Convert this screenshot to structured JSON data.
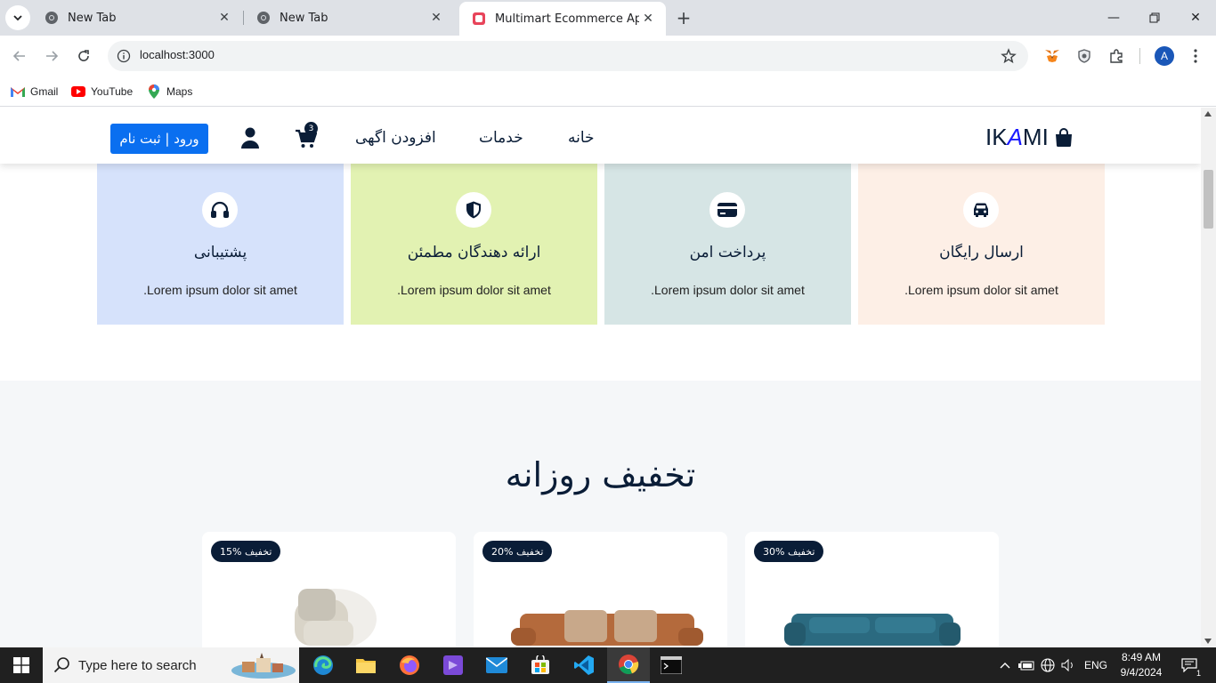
{
  "browser": {
    "tabs": [
      {
        "title": "New Tab"
      },
      {
        "title": "New Tab"
      },
      {
        "title": "Multimart Ecommerce App"
      }
    ],
    "url": "localhost:3000",
    "bookmarks": [
      {
        "label": "Gmail"
      },
      {
        "label": "YouTube"
      },
      {
        "label": "Maps"
      }
    ],
    "profile_initial": "A"
  },
  "site": {
    "logo_prefix": "IK",
    "logo_accent": "A",
    "logo_suffix": "MI",
    "nav": [
      {
        "label": "خانه"
      },
      {
        "label": "خدمات"
      },
      {
        "label": "افزودن اگهی"
      }
    ],
    "cart_count": "3",
    "login_label": "ورود | ثبت نام"
  },
  "services": [
    {
      "title": "ارسال رایگان",
      "desc": ".Lorem ipsum dolor sit amet",
      "icon": "car-icon",
      "bg": "#fdefe6"
    },
    {
      "title": "پرداخت امن",
      "desc": ".Lorem ipsum dolor sit amet",
      "icon": "credit-card-icon",
      "bg": "#d6e5e5"
    },
    {
      "title": "ارائه دهندگان مطمئن",
      "desc": ".Lorem ipsum dolor sit amet",
      "icon": "shield-icon",
      "bg": "#e2f2b2"
    },
    {
      "title": "پشتیبانی",
      "desc": ".Lorem ipsum dolor sit amet",
      "icon": "headphones-icon",
      "bg": "#d6e2fb"
    }
  ],
  "deals": {
    "title": "تخفیف روزانه",
    "products": [
      {
        "badge": "30% تخفیف",
        "image": "teal-sofa"
      },
      {
        "badge": "20% تخفیف",
        "image": "brown-sofa"
      },
      {
        "badge": "15% تخفیف",
        "image": "armchair"
      }
    ]
  },
  "taskbar": {
    "search_placeholder": "Type here to search",
    "language": "ENG",
    "time": "8:49 AM",
    "date": "9/4/2024",
    "notifications": "1"
  }
}
